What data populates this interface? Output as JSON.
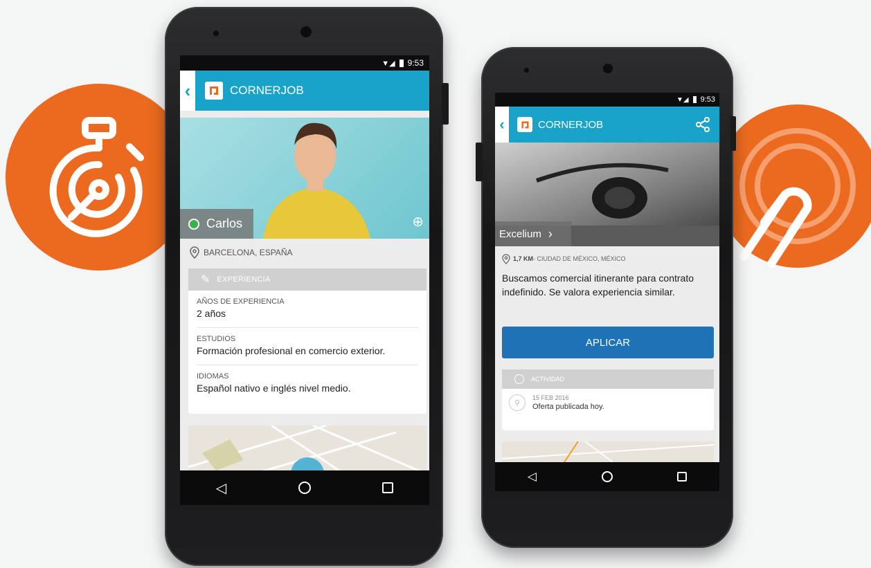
{
  "left_phone": {
    "status_time": "9:53",
    "app_name": "CORNERJOB",
    "candidate_name": "Carlos",
    "location": "BARCELONA, ESPAÑA",
    "section_title": "EXPERIENCIA",
    "fields": [
      {
        "label": "AÑOS DE EXPERIENCIA",
        "value": "2 años"
      },
      {
        "label": "ESTUDIOS",
        "value": "Formación profesional en comercio exterior."
      },
      {
        "label": "IDIOMAS",
        "value": "Español nativo e inglés nivel medio."
      }
    ]
  },
  "right_phone": {
    "status_time": "9:53",
    "app_name": "CORNERJOB",
    "company": "Excelium",
    "distance": "1,7 KM",
    "location": " - CIUDAD DE MÉXICO, MÉXICO",
    "description": "Buscamos comercial itinerante para contrato indefinido. Se valora experiencia similar.",
    "apply_label": "APLICAR",
    "activity_title": "ACTIVIDAD",
    "activity_date": "15 FEB 2016",
    "activity_text": "Oferta publicada hoy."
  },
  "colors": {
    "accent_orange": "#ec6a1f",
    "app_blue": "#1aa3c9",
    "apply_blue": "#1f72b5",
    "online_green": "#38b24a"
  },
  "icons": {
    "left_badge": "stopwatch-icon",
    "right_badge": "tap-finger-icon"
  }
}
